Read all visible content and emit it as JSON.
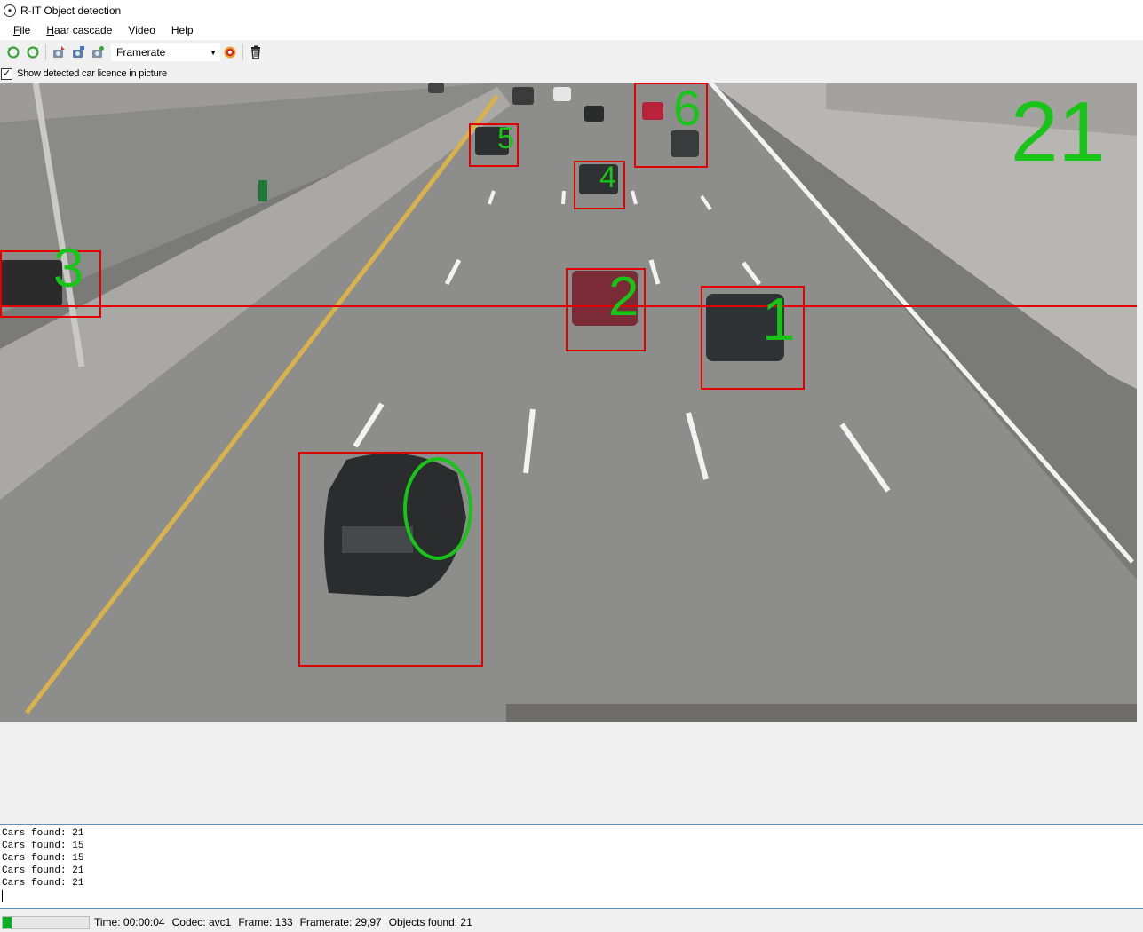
{
  "window": {
    "title": "R-IT Object detection"
  },
  "menu": [
    {
      "accel": "F",
      "rest": "ile"
    },
    {
      "accel": "H",
      "rest": "aar cascade"
    },
    {
      "accel": "",
      "rest": "Video"
    },
    {
      "accel": "",
      "rest": "Help"
    }
  ],
  "toolbar": {
    "combo_value": "Framerate",
    "icons": [
      "rotate-left-icon",
      "rotate-right-icon",
      "camera-capture-icon",
      "camera-open-icon",
      "camera-settings-icon",
      "record-icon",
      "delete-icon"
    ]
  },
  "options": {
    "show_licence_label": "Show detected car licence in picture",
    "show_licence_checked": true
  },
  "video": {
    "total_count": "21",
    "detection_labels": [
      "1",
      "2",
      "3",
      "4",
      "5",
      "6"
    ],
    "box_color": "#e00000",
    "label_color": "#19c419",
    "counting_line_color": "#e00000"
  },
  "log": {
    "lines": [
      "Cars found: 21",
      "Cars found: 15",
      "Cars found: 15",
      "Cars found: 21",
      "Cars found: 21"
    ]
  },
  "status": {
    "progress": 0.1,
    "time": "Time: 00:00:04",
    "codec": "Codec: avc1",
    "frame": "Frame: 133",
    "framerate": "Framerate: 29,97",
    "objects": "Objects found: 21"
  }
}
